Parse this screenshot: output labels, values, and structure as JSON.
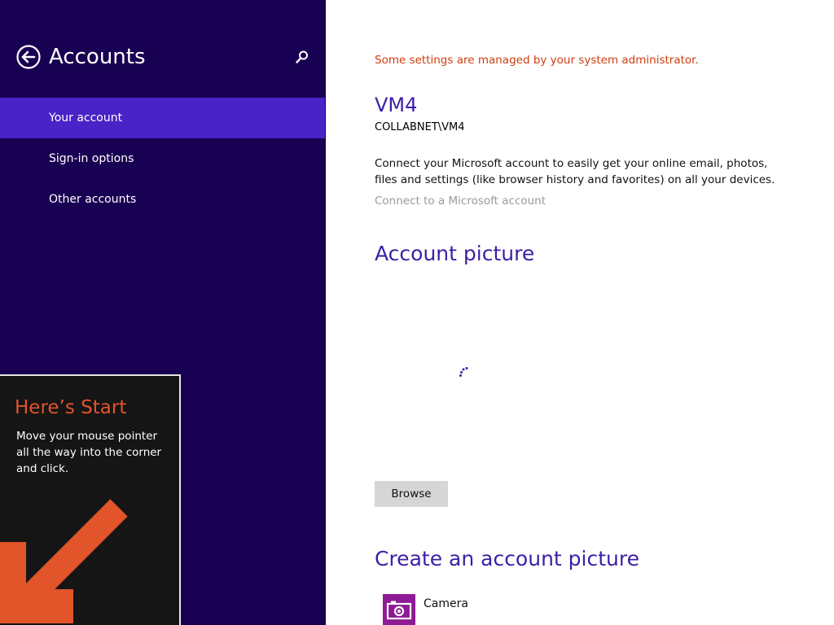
{
  "nav": {
    "title": "Accounts",
    "back_icon": "back-arrow-icon",
    "search_icon": "search-icon",
    "items": [
      {
        "label": "Your account",
        "selected": true
      },
      {
        "label": "Sign-in options",
        "selected": false
      },
      {
        "label": "Other accounts",
        "selected": false
      }
    ],
    "colors": {
      "pane_bg": "#180052",
      "selected_bg": "#4a23c7"
    }
  },
  "start_tip": {
    "title": "Here’s Start",
    "body": "Move your mouse pointer all the way into the corner and click.",
    "arrow_icon": "corner-arrow-icon",
    "title_color": "#e2542a"
  },
  "content": {
    "admin_notice": "Some settings are managed by your system administrator.",
    "user_name": "VM4",
    "user_domain": "COLLABNET\\VM4",
    "connect_description": "Connect your Microsoft account to easily get your online email, photos, files and settings (like browser history and favorites) on all your devices.",
    "connect_link": "Connect to a Microsoft account",
    "account_picture_heading": "Account picture",
    "loading_icon": "loading-spinner-icon",
    "browse_label": "Browse",
    "create_heading": "Create an account picture",
    "camera": {
      "label": "Camera",
      "icon": "camera-icon",
      "tile_color": "#8e1a96"
    },
    "colors": {
      "heading": "#3c1fa6",
      "notice": "#cf3c10",
      "link_disabled": "#9a9a9a"
    }
  }
}
